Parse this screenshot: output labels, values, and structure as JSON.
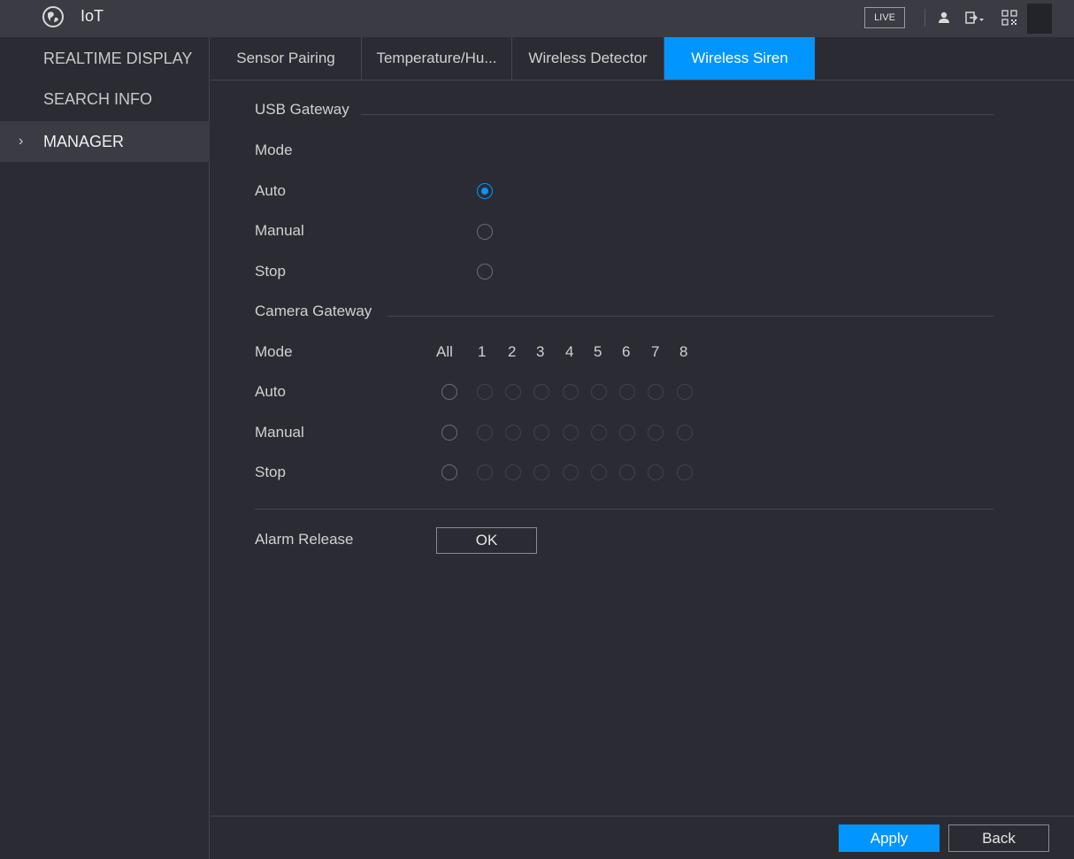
{
  "header": {
    "title": "IoT",
    "app_icon": "globe-icon",
    "live_label": "LIVE",
    "icons": [
      "user-icon",
      "logout-icon",
      "qr-code-icon"
    ]
  },
  "sidebar": {
    "items": [
      {
        "label": "REALTIME DISPLAY",
        "active": false
      },
      {
        "label": "SEARCH INFO",
        "active": false
      },
      {
        "label": "MANAGER",
        "active": true
      }
    ],
    "active_arrow": "›"
  },
  "tabs": [
    {
      "label": "Sensor Pairing",
      "active": false
    },
    {
      "label": "Temperature/Hu...",
      "active": false
    },
    {
      "label": "Wireless Detector",
      "active": false
    },
    {
      "label": "Wireless Siren",
      "active": true
    }
  ],
  "usb_gateway": {
    "title": "USB Gateway",
    "mode_label": "Mode",
    "options": [
      "Auto",
      "Manual",
      "Stop"
    ],
    "selected": "Auto"
  },
  "camera_gateway": {
    "title": "Camera Gateway",
    "mode_label": "Mode",
    "columns": [
      "All",
      "1",
      "2",
      "3",
      "4",
      "5",
      "6",
      "7",
      "8"
    ],
    "options": [
      "Auto",
      "Manual",
      "Stop"
    ]
  },
  "alarm_release": {
    "label": "Alarm Release",
    "button": "OK"
  },
  "footer": {
    "apply": "Apply",
    "back": "Back"
  },
  "colors": {
    "accent": "#0095ff",
    "background": "#2b2c33",
    "topbar": "#3a3b43"
  }
}
